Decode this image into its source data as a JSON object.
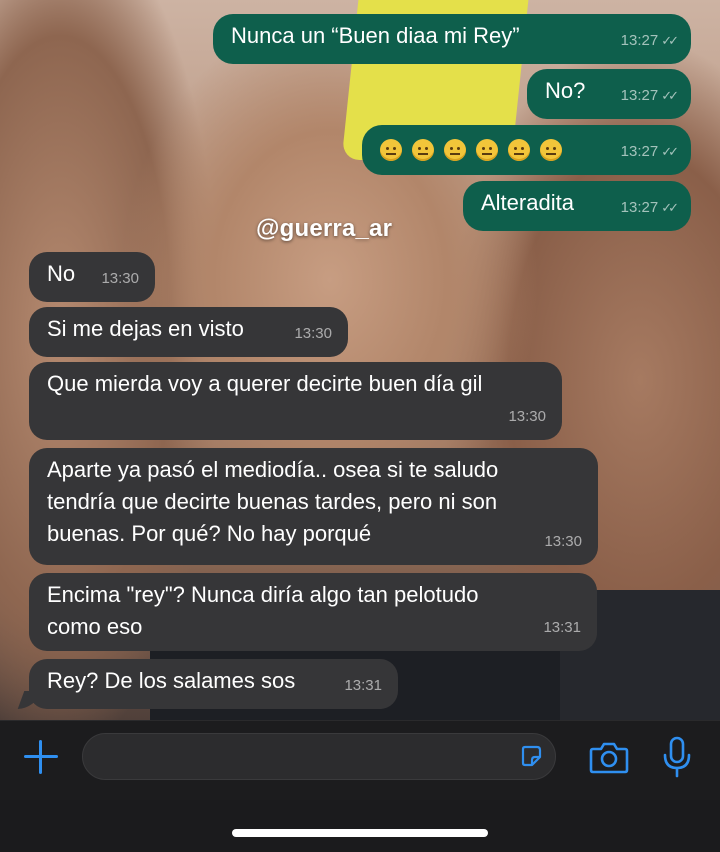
{
  "watermark": "@guerra_ar",
  "messages": [
    {
      "text": "Nunca un “Buen diaa mi Rey”",
      "time": "13:27",
      "ticks": "✓✓"
    },
    {
      "text": "No?",
      "time": "13:27",
      "ticks": "✓✓"
    },
    {
      "text": "",
      "emoji": "slightly-frowning-face x6",
      "time": "13:27",
      "ticks": "✓✓"
    },
    {
      "text": "Alteradita",
      "time": "13:27",
      "ticks": "✓✓"
    },
    {
      "text": "No",
      "time": "13:30"
    },
    {
      "text": "Si me dejas en visto",
      "time": "13:30"
    },
    {
      "text": "Que mierda voy a querer decirte buen día gil",
      "time": "13:30"
    },
    {
      "line1": "Aparte ya pasó el mediodía.. osea si te saludo",
      "line2": "tendría que decirte buenas tardes, pero ni son",
      "line3": "buenas. Por qué? No hay porqué",
      "time": "13:30"
    },
    {
      "line1": "Encima \"rey\"? Nunca diría algo tan pelotudo",
      "line2": "como eso",
      "time": "13:31"
    },
    {
      "text": "Rey? De los salames sos",
      "time": "13:31"
    }
  ],
  "input": {
    "placeholder": ""
  },
  "icons": {
    "attach": "plus-icon",
    "sticker": "sticker-icon",
    "camera": "camera-icon",
    "mic": "microphone-icon"
  },
  "colors": {
    "outgoing_bubble": "#0e5f4c",
    "incoming_bubble": "#363638",
    "accent": "#2f8ff0"
  }
}
